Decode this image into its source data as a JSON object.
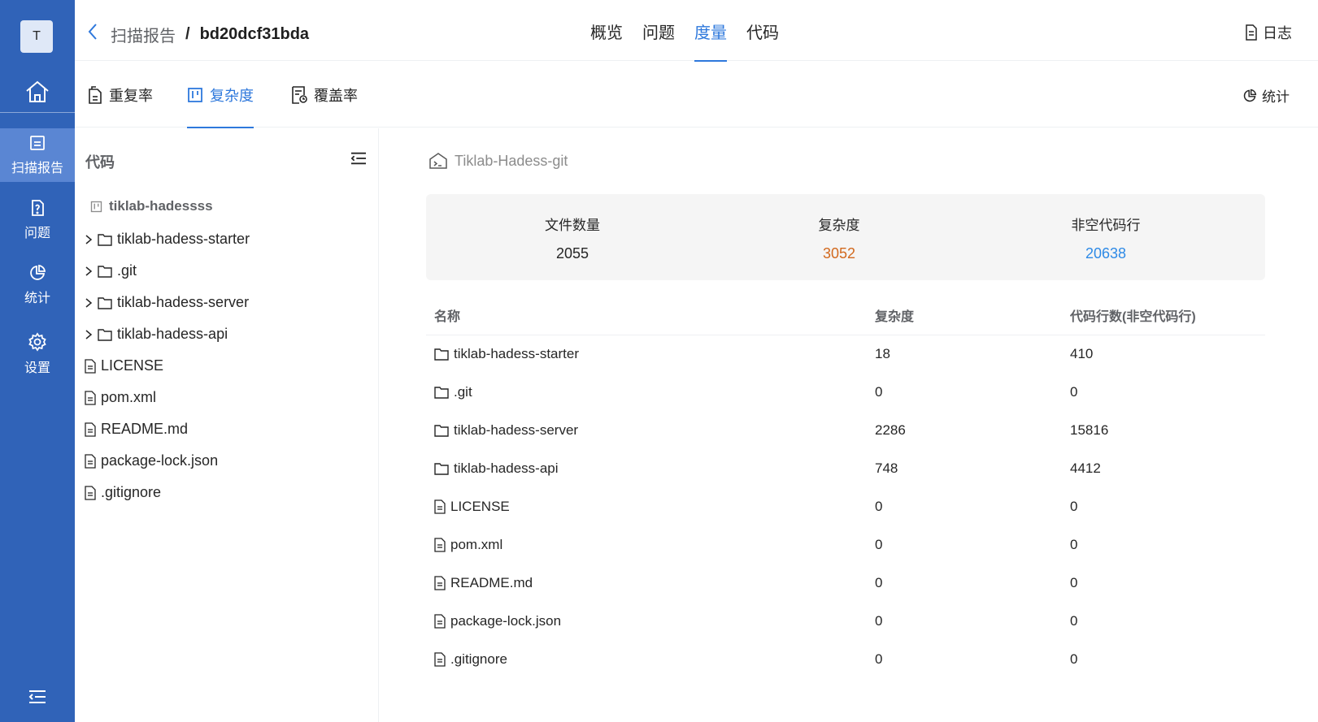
{
  "sidebar": {
    "avatar_letter": "T",
    "items": [
      {
        "label": "扫描报告",
        "icon": "report-icon",
        "active": true
      },
      {
        "label": "问题",
        "icon": "question-doc-icon",
        "active": false
      },
      {
        "label": "统计",
        "icon": "pie-chart-icon",
        "active": false
      },
      {
        "label": "设置",
        "icon": "gear-icon",
        "active": false
      }
    ]
  },
  "header": {
    "breadcrumb_parent": "扫描报告",
    "breadcrumb_sep": "/",
    "breadcrumb_current": "bd20dcf31bda",
    "tabs": [
      "概览",
      "问题",
      "度量",
      "代码"
    ],
    "active_tab": "度量",
    "log_label": "日志"
  },
  "subtabs": {
    "items": [
      "重复率",
      "复杂度",
      "覆盖率"
    ],
    "active": "复杂度",
    "stats_label": "统计"
  },
  "tree": {
    "title": "代码",
    "root": "tiklab-hadessss",
    "folders": [
      "tiklab-hadess-starter",
      ".git",
      "tiklab-hadess-server",
      "tiklab-hadess-api"
    ],
    "files": [
      "LICENSE",
      "pom.xml",
      "README.md",
      "package-lock.json",
      ".gitignore"
    ]
  },
  "main": {
    "project": "Tiklab-Hadess-git",
    "summary": {
      "files_label": "文件数量",
      "files_value": "2055",
      "complexity_label": "复杂度",
      "complexity_value": "3052",
      "lines_label": "非空代码行",
      "lines_value": "20638"
    },
    "table": {
      "headers": [
        "名称",
        "复杂度",
        "代码行数(非空代码行)"
      ],
      "rows": [
        {
          "name": "tiklab-hadess-starter",
          "type": "folder",
          "complexity": "18",
          "lines": "410"
        },
        {
          "name": ".git",
          "type": "folder",
          "complexity": "0",
          "lines": "0"
        },
        {
          "name": "tiklab-hadess-server",
          "type": "folder",
          "complexity": "2286",
          "lines": "15816"
        },
        {
          "name": "tiklab-hadess-api",
          "type": "folder",
          "complexity": "748",
          "lines": "4412"
        },
        {
          "name": "LICENSE",
          "type": "file",
          "complexity": "0",
          "lines": "0"
        },
        {
          "name": "pom.xml",
          "type": "file",
          "complexity": "0",
          "lines": "0"
        },
        {
          "name": "README.md",
          "type": "file",
          "complexity": "0",
          "lines": "0"
        },
        {
          "name": "package-lock.json",
          "type": "file",
          "complexity": "0",
          "lines": "0"
        },
        {
          "name": ".gitignore",
          "type": "file",
          "complexity": "0",
          "lines": "0"
        }
      ]
    }
  },
  "colors": {
    "sidebar_bg": "#3063b8",
    "accent": "#2e78dc",
    "complexity_value": "#d2691e",
    "lines_value": "#2e8ae6"
  }
}
